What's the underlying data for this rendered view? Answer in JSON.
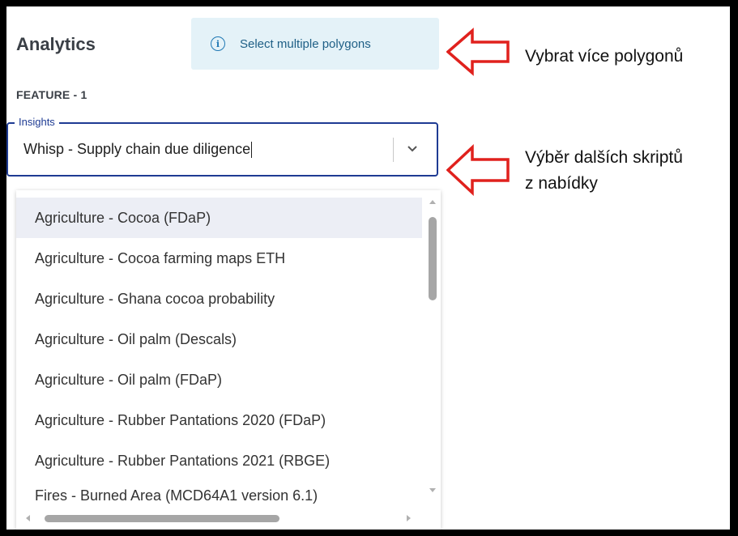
{
  "analytics": {
    "title": "Analytics",
    "hint": {
      "icon": "info-icon",
      "text": "Select multiple polygons"
    },
    "feature_label": "FEATURE - 1",
    "insights": {
      "label": "Insights",
      "value": "Whisp - Supply chain due diligence",
      "options": [
        "Agriculture - Cocoa (FDaP)",
        "Agriculture - Cocoa farming maps ETH",
        "Agriculture - Ghana cocoa probability",
        "Agriculture - Oil palm (Descals)",
        "Agriculture - Oil palm (FDaP)",
        "Agriculture - Rubber Pantations 2020 (FDaP)",
        "Agriculture - Rubber Pantations 2021 (RBGE)",
        "Fires - Burned Area (MCD64A1 version 6.1)"
      ],
      "highlighted_index": 0
    }
  },
  "annotations": {
    "first": "Vybrat více polygonů",
    "second_line1": "Výběr dalších skriptů",
    "second_line2": "z nabídky",
    "arrow_color": "#e0211d"
  },
  "colors": {
    "accent": "#1e3b93",
    "hint_bg": "#e4f2f8",
    "hint_text": "#1e5f86",
    "highlight_bg": "#eceef5"
  }
}
